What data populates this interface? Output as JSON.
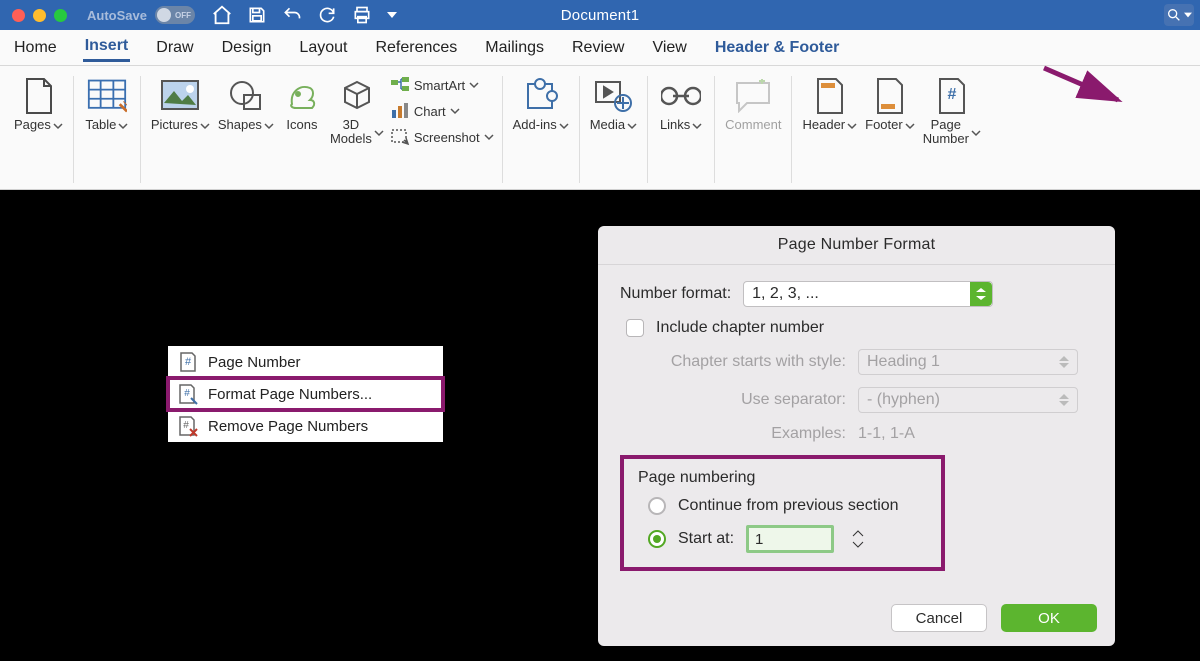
{
  "title_bar": {
    "autosave_label": "AutoSave",
    "autosave_switch_text": "OFF",
    "doc_title": "Document1"
  },
  "tabs": {
    "items": [
      "Home",
      "Insert",
      "Draw",
      "Design",
      "Layout",
      "References",
      "Mailings",
      "Review",
      "View",
      "Header & Footer"
    ],
    "active_index": 1,
    "context_index": 9
  },
  "ribbon": {
    "pages": "Pages",
    "table": "Table",
    "pictures": "Pictures",
    "shapes": "Shapes",
    "icons": "Icons",
    "models": "3D\nModels",
    "smartart": "SmartArt",
    "chart": "Chart",
    "screenshot": "Screenshot",
    "addins": "Add-ins",
    "media": "Media",
    "links": "Links",
    "comment": "Comment",
    "header": "Header",
    "footer": "Footer",
    "page_number": "Page\nNumber"
  },
  "context_menu": {
    "items": [
      {
        "label": "Page Number"
      },
      {
        "label": "Format Page Numbers..."
      },
      {
        "label": "Remove Page Numbers"
      }
    ],
    "highlight_index": 1
  },
  "dialog": {
    "title": "Page Number Format",
    "number_format_label": "Number format:",
    "number_format_value": "1, 2, 3, ...",
    "include_chapter_label": "Include chapter number",
    "chapter_style_label": "Chapter starts with style:",
    "chapter_style_value": "Heading 1",
    "separator_label": "Use separator:",
    "separator_value": "-    (hyphen)",
    "examples_label": "Examples:",
    "examples_value": "1-1, 1-A",
    "page_numbering_label": "Page numbering",
    "continue_label": "Continue from previous section",
    "start_at_label": "Start at:",
    "start_at_value": "1",
    "cancel": "Cancel",
    "ok": "OK"
  }
}
